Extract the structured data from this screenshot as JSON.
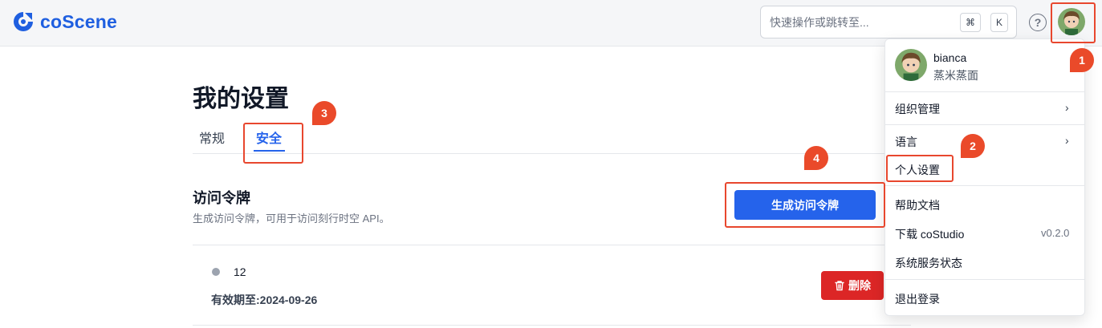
{
  "header": {
    "logo_text": "coScene",
    "search_placeholder": "快速操作或跳转至...",
    "shortcut_cmd": "⌘",
    "shortcut_k": "K",
    "help_glyph": "?",
    "brand_color": "#1f5fe0"
  },
  "page": {
    "title": "我的设置",
    "tabs": [
      {
        "label": "常规",
        "active": false
      },
      {
        "label": "安全",
        "active": true
      }
    ],
    "section": {
      "title": "访问令牌",
      "description": "生成访问令牌，可用于访问刻行时空 API。",
      "generate_button": "生成访问令牌"
    },
    "tokens": [
      {
        "name": "12",
        "expiry": "有效期至:2024-09-26",
        "delete_label": "删除"
      }
    ]
  },
  "user_menu": {
    "username": "bianca",
    "organization": "蒸米蒸面",
    "items": [
      {
        "label": "组织管理",
        "chevron": true
      },
      {
        "label": "语言",
        "chevron": true
      },
      {
        "label": "个人设置"
      },
      {
        "label": "帮助文档"
      },
      {
        "label": "下载 coStudio",
        "version": "v0.2.0"
      },
      {
        "label": "系统服务状态"
      },
      {
        "label": "退出登录"
      }
    ]
  },
  "annotations": [
    "1",
    "2",
    "3",
    "4"
  ],
  "colors": {
    "accent": "#2563eb",
    "danger": "#dc2626",
    "annotation": "#e8472e"
  }
}
